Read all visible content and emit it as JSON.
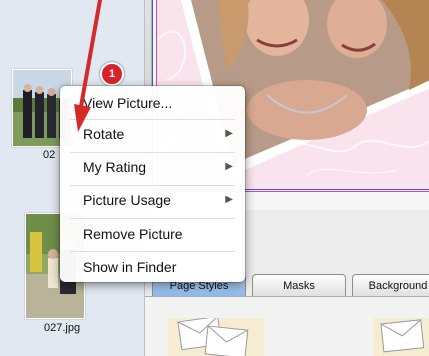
{
  "sidebar": {
    "photos": [
      {
        "caption": "02",
        "badge": "1"
      },
      {
        "caption": "027.jpg"
      }
    ]
  },
  "context_menu": {
    "items": [
      {
        "label": "View Picture...",
        "submenu": false
      },
      {
        "label": "Rotate",
        "submenu": true
      },
      {
        "label": "My Rating",
        "submenu": true
      },
      {
        "label": "Picture Usage",
        "submenu": true
      },
      {
        "label": "Remove Picture",
        "submenu": false
      },
      {
        "label": "Show in Finder",
        "submenu": false
      }
    ],
    "submenu_glyph": "▶"
  },
  "tabs": [
    {
      "label": "Page Styles",
      "active": true
    },
    {
      "label": "Masks",
      "active": false
    },
    {
      "label": "Background",
      "active": false
    }
  ],
  "colors": {
    "annotation_arrow": "#d42a2a",
    "page_background": "#f9e4ee",
    "page_border": "#d64d8a",
    "guide_line": "#3a57e8",
    "badge": "#d8232a"
  }
}
